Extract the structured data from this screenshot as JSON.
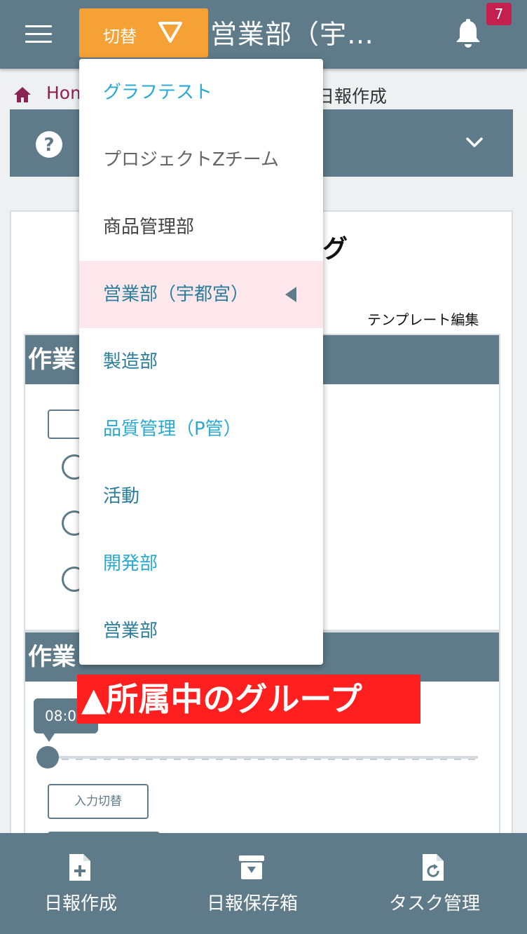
{
  "header": {
    "switch_label": "切替",
    "title": "営業部（宇…",
    "notification_count": "7"
  },
  "breadcrumb": {
    "home": "Hom",
    "current": "日報作成"
  },
  "page": {
    "title_tail": "グ",
    "template_edit": "テンプレート編集",
    "section1_title": "作業",
    "section2_title": "作業",
    "time_value": "08:0",
    "input_switch": "入力切替"
  },
  "group_menu": {
    "items": [
      {
        "label": "グラフテスト",
        "color": "#2aa9d2"
      },
      {
        "label": "プロジェクトZチーム",
        "color": "#666666"
      },
      {
        "label": "商品管理部",
        "color": "#444444"
      },
      {
        "label": "営業部（宇都宮）",
        "color": "#2a7d9c",
        "selected": true
      },
      {
        "label": "製造部",
        "color": "#2a7d9c"
      },
      {
        "label": "品質管理（P管）",
        "color": "#2aa9d2"
      },
      {
        "label": "活動",
        "color": "#2a7d9c"
      },
      {
        "label": "開発部",
        "color": "#2aa9d2"
      },
      {
        "label": "営業部",
        "color": "#2a7d9c"
      }
    ]
  },
  "annotation": "▲所属中のグループ",
  "bottom_nav": {
    "items": [
      {
        "label": "日報作成",
        "icon": "file-plus-icon"
      },
      {
        "label": "日報保存箱",
        "icon": "archive-icon"
      },
      {
        "label": "タスク管理",
        "icon": "file-refresh-icon"
      }
    ]
  },
  "colors": {
    "primary": "#5f7b8a",
    "accent": "#f6a135",
    "badge": "#c3204f",
    "annotation": "#ff1f1f"
  }
}
